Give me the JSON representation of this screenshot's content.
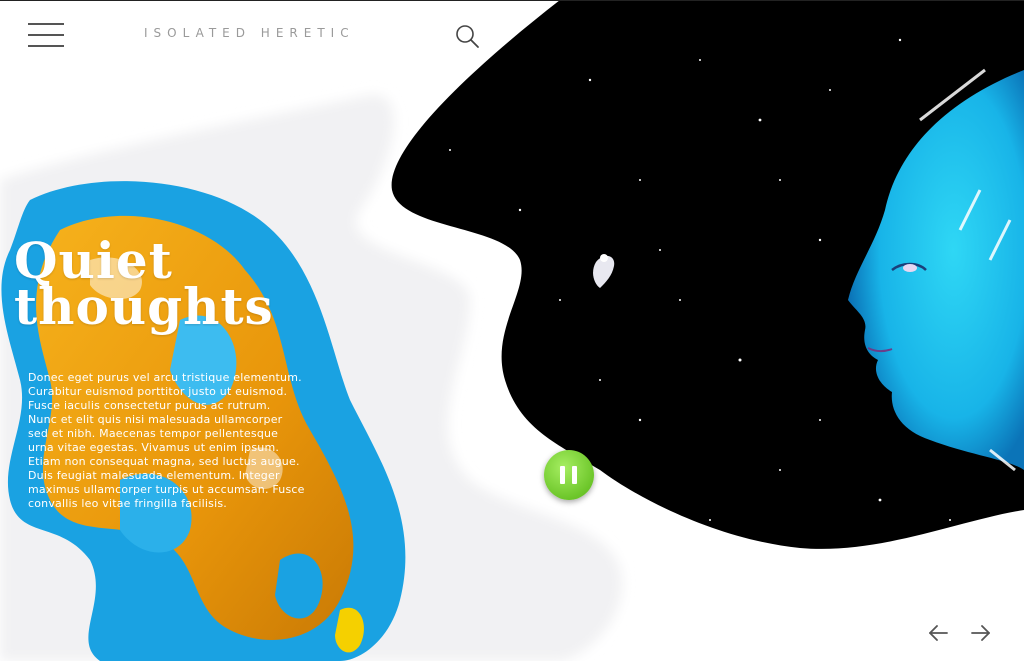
{
  "header": {
    "brand": "ISOLATED HERETIC",
    "menu_icon": "hamburger-menu-icon",
    "search_icon": "search-icon"
  },
  "hero": {
    "title_line1": "Quiet",
    "title_line2": "thoughts",
    "body_lines": [
      "Donec eget purus vel arcu tristique elementum.",
      "Curabitur euismod porttitor justo ut euismod.",
      "Fusce iaculis consectetur purus ac rutrum.",
      "Nunc et elit quis nisi malesuada ullamcorper",
      "sed et nibh. Maecenas tempor pellentesque",
      "urna vitae egestas. Vivamus ut enim ipsum.",
      "Etiam non consequat magna, sed luctus augue.",
      "Duis feugiat malesuada elementum. Integer",
      "maximus ullamcorper turpis ut accumsan. Fusce",
      "convallis leo vitae fringilla facilisis."
    ]
  },
  "controls": {
    "pause_icon": "pause-icon",
    "prev_icon": "arrow-left-icon",
    "next_icon": "arrow-right-icon"
  },
  "colors": {
    "accent_green": "#7fd83a",
    "paint_orange": "#f2a20c",
    "paint_blue": "#1ea8e6",
    "face_cyan": "#2fd0f0",
    "space_black": "#000000"
  }
}
